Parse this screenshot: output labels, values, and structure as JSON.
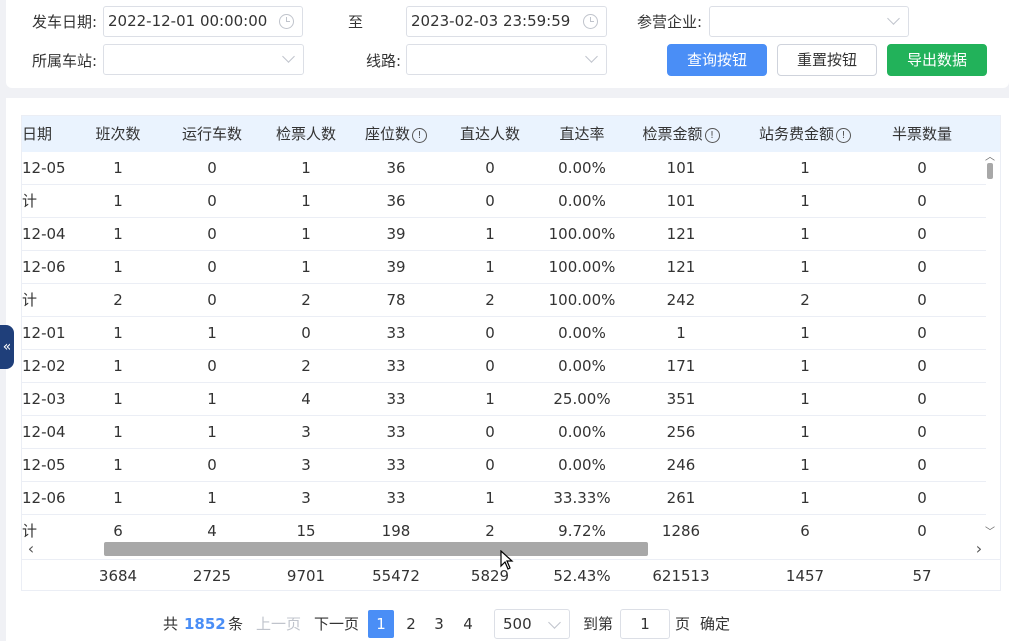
{
  "filters": {
    "depart_date_label": "发车日期:",
    "depart_date_start": "2022-12-01 00:00:00",
    "to_label": "至",
    "depart_date_end": "2023-02-03 23:59:59",
    "company_label": "参营企业:",
    "company_value": "",
    "station_label": "所属车站:",
    "station_value": "",
    "route_label": "线路:",
    "route_value": ""
  },
  "buttons": {
    "query": "查询按钮",
    "reset": "重置按钮",
    "export": "导出数据"
  },
  "table": {
    "columns": [
      "日期",
      "班次数",
      "运行车数",
      "检票人数",
      "座位数",
      "直达人数",
      "直达率",
      "检票金额",
      "站务费金额",
      "半票数量"
    ],
    "info_columns": [
      4,
      7,
      8
    ],
    "rows": [
      [
        "12-05",
        "1",
        "0",
        "1",
        "36",
        "0",
        "0.00%",
        "101",
        "1",
        "0"
      ],
      [
        "计",
        "1",
        "0",
        "1",
        "36",
        "0",
        "0.00%",
        "101",
        "1",
        "0"
      ],
      [
        "12-04",
        "1",
        "0",
        "1",
        "39",
        "1",
        "100.00%",
        "121",
        "1",
        "0"
      ],
      [
        "12-06",
        "1",
        "0",
        "1",
        "39",
        "1",
        "100.00%",
        "121",
        "1",
        "0"
      ],
      [
        "计",
        "2",
        "0",
        "2",
        "78",
        "2",
        "100.00%",
        "242",
        "2",
        "0"
      ],
      [
        "12-01",
        "1",
        "1",
        "0",
        "33",
        "0",
        "0.00%",
        "1",
        "1",
        "0"
      ],
      [
        "12-02",
        "1",
        "0",
        "2",
        "33",
        "0",
        "0.00%",
        "171",
        "1",
        "0"
      ],
      [
        "12-03",
        "1",
        "1",
        "4",
        "33",
        "1",
        "25.00%",
        "351",
        "1",
        "0"
      ],
      [
        "12-04",
        "1",
        "1",
        "3",
        "33",
        "0",
        "0.00%",
        "256",
        "1",
        "0"
      ],
      [
        "12-05",
        "1",
        "0",
        "3",
        "33",
        "0",
        "0.00%",
        "246",
        "1",
        "0"
      ],
      [
        "12-06",
        "1",
        "1",
        "3",
        "33",
        "1",
        "33.33%",
        "261",
        "1",
        "0"
      ],
      [
        "计",
        "6",
        "4",
        "15",
        "198",
        "2",
        "9.72%",
        "1286",
        "6",
        "0"
      ]
    ],
    "summary": [
      "",
      "3684",
      "2725",
      "9701",
      "55472",
      "5829",
      "52.43%",
      "621513",
      "1457",
      "57"
    ]
  },
  "pagination": {
    "total_prefix": "共",
    "total": "1852",
    "total_suffix": "条",
    "prev": "上一页",
    "next": "下一页",
    "pages": [
      "1",
      "2",
      "3",
      "4"
    ],
    "active_page": "1",
    "page_size": "500",
    "goto_prefix": "到第",
    "goto_value": "1",
    "goto_suffix": "页",
    "confirm": "确定"
  },
  "side_tab_icon": "«",
  "colors": {
    "primary": "#4a8ef6",
    "success": "#22b25a",
    "header_bg": "#eaf3fe",
    "side_tab": "#1f3f7a"
  }
}
